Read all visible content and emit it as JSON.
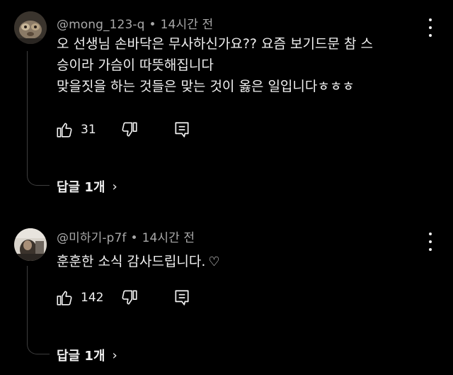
{
  "comments": [
    {
      "author": "@mong_123-q",
      "separator": "•",
      "time": "14시간 전",
      "lines": [
        "오 선생님 손바닥은 무사하신가요?? 요즘 보기드문 참 스",
        "승이라 가슴이 따뜻해집니다",
        "맞을짓을 하는 것들은 맞는 것이 옳은 일입니다ㅎㅎㅎ"
      ],
      "likes": "31",
      "replies_label": "답글 1개",
      "chevron": "›"
    },
    {
      "author": "@미하기-p7f",
      "separator": "•",
      "time": "14시간 전",
      "lines": [
        "훈훈한 소식 감사드립니다."
      ],
      "heart": "♡",
      "likes": "142",
      "replies_label": "답글 1개",
      "chevron": "›"
    }
  ],
  "icons": {
    "like": "thumbs-up-icon",
    "dislike": "thumbs-down-icon",
    "reply": "reply-icon",
    "menu": "more-vert-icon"
  }
}
